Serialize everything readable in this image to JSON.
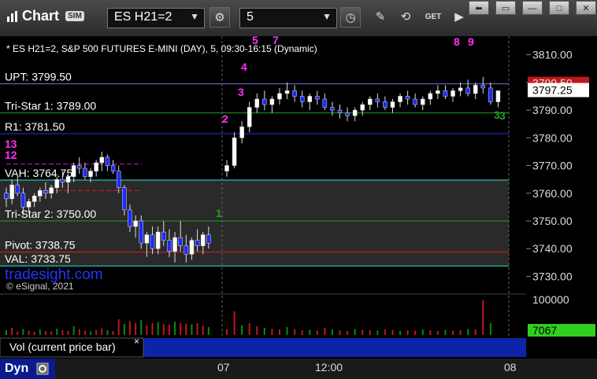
{
  "app": {
    "title": "Chart",
    "sim_badge": "SIM",
    "symbol": "ES H21=2",
    "interval": "5",
    "get_label": "GET"
  },
  "chart": {
    "header": "* ES H21=2, S&P 500 FUTURES E-MINI (DAY), 5, 09:30-16:15 (Dynamic)",
    "watermark": "tradesight.com",
    "copyright": "© eSignal, 2021",
    "levels": [
      {
        "label": "UPT: 3799.50",
        "value": 3799.5,
        "color": "#7b6fe0"
      },
      {
        "label": "Tri-Star 1: 3789.00",
        "value": 3789.0,
        "color": "#1fa01f"
      },
      {
        "label": "R1: 3781.50",
        "value": 3781.5,
        "color": "#2235e0"
      },
      {
        "label": "VAH: 3764.75",
        "value": 3764.75,
        "color": "#2fe0d6"
      },
      {
        "label": "Tri-Star 2: 3750.00",
        "value": 3750.0,
        "color": "#1fa01f"
      },
      {
        "label": "Pivot: 3738.75",
        "value": 3738.75,
        "color": "#e01f1f"
      },
      {
        "label": "VAL: 3733.75",
        "value": 3733.75,
        "color": "#2fe0d6"
      }
    ],
    "price_ticks": [
      "3810.00",
      "3800.00",
      "3790.00",
      "3780.00",
      "3770.00",
      "3760.00",
      "3750.00",
      "3740.00",
      "3730.00"
    ],
    "last_price_red": "3799.50",
    "last_price": "3797.25",
    "volume_tick": "100000",
    "volume_last": "7067",
    "volume_panel_label": "Vol (current price bar)",
    "time_ticks": [
      "07",
      "12:00",
      "08"
    ],
    "dyn_label": "Dyn",
    "markers": [
      {
        "text": "13",
        "color": "#ff2fff"
      },
      {
        "text": "12",
        "color": "#ff2fff"
      },
      {
        "text": "2",
        "color": "#ff2fff"
      },
      {
        "text": "3",
        "color": "#ff2fff"
      },
      {
        "text": "4",
        "color": "#ff2fff"
      },
      {
        "text": "5",
        "color": "#ff2fff"
      },
      {
        "text": "7",
        "color": "#ff2fff"
      },
      {
        "text": "8",
        "color": "#ff2fff"
      },
      {
        "text": "9",
        "color": "#ff2fff"
      },
      {
        "text": "1",
        "color": "#1fa01f"
      },
      {
        "text": "3",
        "color": "#1fa01f"
      },
      {
        "text": "3",
        "color": "#1fa01f"
      }
    ]
  },
  "chart_data": {
    "type": "candlestick",
    "y_range": [
      3727,
      3815
    ],
    "candles": [
      [
        3760,
        3762,
        3755,
        3758
      ],
      [
        3758,
        3765,
        3756,
        3763
      ],
      [
        3763,
        3766,
        3759,
        3760
      ],
      [
        3760,
        3762,
        3752,
        3755
      ],
      [
        3755,
        3758,
        3753,
        3757
      ],
      [
        3757,
        3760,
        3755,
        3759
      ],
      [
        3759,
        3762,
        3757,
        3761
      ],
      [
        3761,
        3764,
        3758,
        3760
      ],
      [
        3760,
        3763,
        3758,
        3762
      ],
      [
        3762,
        3766,
        3760,
        3765
      ],
      [
        3765,
        3768,
        3762,
        3764
      ],
      [
        3764,
        3767,
        3760,
        3766
      ],
      [
        3766,
        3771,
        3764,
        3770
      ],
      [
        3770,
        3773,
        3767,
        3769
      ],
      [
        3769,
        3771,
        3765,
        3766
      ],
      [
        3766,
        3769,
        3764,
        3768
      ],
      [
        3768,
        3772,
        3766,
        3771
      ],
      [
        3771,
        3775,
        3768,
        3773
      ],
      [
        3773,
        3774,
        3768,
        3770
      ],
      [
        3770,
        3772,
        3767,
        3768
      ],
      [
        3768,
        3770,
        3760,
        3762
      ],
      [
        3762,
        3763,
        3752,
        3754
      ],
      [
        3754,
        3756,
        3746,
        3748
      ],
      [
        3748,
        3752,
        3744,
        3750
      ],
      [
        3750,
        3752,
        3740,
        3742
      ],
      [
        3742,
        3746,
        3737,
        3745
      ],
      [
        3745,
        3748,
        3738,
        3740
      ],
      [
        3740,
        3748,
        3738,
        3746
      ],
      [
        3746,
        3750,
        3741,
        3743
      ],
      [
        3743,
        3747,
        3737,
        3739
      ],
      [
        3739,
        3746,
        3735,
        3744
      ],
      [
        3744,
        3750,
        3739,
        3741
      ],
      [
        3741,
        3745,
        3735,
        3738
      ],
      [
        3738,
        3744,
        3736,
        3743
      ],
      [
        3743,
        3747,
        3739,
        3741
      ],
      [
        3741,
        3746,
        3738,
        3745
      ],
      [
        3745,
        3748,
        3740,
        3742
      ],
      [
        3768,
        3772,
        3766,
        3770
      ],
      [
        3770,
        3782,
        3769,
        3780
      ],
      [
        3780,
        3786,
        3778,
        3784
      ],
      [
        3784,
        3793,
        3782,
        3791
      ],
      [
        3791,
        3796,
        3789,
        3794
      ],
      [
        3794,
        3797,
        3790,
        3792
      ],
      [
        3792,
        3795,
        3789,
        3794
      ],
      [
        3794,
        3798,
        3792,
        3796
      ],
      [
        3796,
        3800,
        3794,
        3797
      ],
      [
        3797,
        3799,
        3793,
        3795
      ],
      [
        3795,
        3797,
        3791,
        3793
      ],
      [
        3793,
        3796,
        3790,
        3795
      ],
      [
        3795,
        3797,
        3792,
        3794
      ],
      [
        3794,
        3796,
        3790,
        3791
      ],
      [
        3791,
        3793,
        3788,
        3790
      ],
      [
        3790,
        3792,
        3787,
        3789
      ],
      [
        3789,
        3791,
        3786,
        3788
      ],
      [
        3788,
        3791,
        3786,
        3790
      ],
      [
        3790,
        3793,
        3788,
        3792
      ],
      [
        3792,
        3795,
        3790,
        3794
      ],
      [
        3794,
        3796,
        3791,
        3793
      ],
      [
        3793,
        3795,
        3790,
        3791
      ],
      [
        3791,
        3794,
        3789,
        3793
      ],
      [
        3793,
        3796,
        3791,
        3795
      ],
      [
        3795,
        3797,
        3792,
        3794
      ],
      [
        3794,
        3796,
        3791,
        3792
      ],
      [
        3792,
        3795,
        3790,
        3794
      ],
      [
        3794,
        3797,
        3792,
        3796
      ],
      [
        3796,
        3799,
        3794,
        3797
      ],
      [
        3797,
        3799,
        3794,
        3795
      ],
      [
        3795,
        3798,
        3793,
        3797
      ],
      [
        3797,
        3800,
        3795,
        3798
      ],
      [
        3798,
        3801,
        3795,
        3796
      ],
      [
        3796,
        3800,
        3794,
        3799
      ],
      [
        3799,
        3802,
        3796,
        3798
      ],
      [
        3798,
        3800,
        3792,
        3793
      ],
      [
        3793,
        3797,
        3791,
        3797
      ]
    ],
    "volume": [
      12,
      18,
      9,
      15,
      11,
      8,
      14,
      10,
      9,
      16,
      12,
      10,
      22,
      15,
      11,
      9,
      13,
      17,
      12,
      10,
      40,
      28,
      35,
      30,
      38,
      25,
      30,
      33,
      28,
      26,
      34,
      31,
      29,
      27,
      30,
      24,
      20,
      15,
      60,
      25,
      30,
      22,
      18,
      16,
      14,
      20,
      15,
      12,
      13,
      11,
      18,
      14,
      12,
      10,
      15,
      13,
      12,
      11,
      14,
      13,
      10,
      12,
      11,
      14,
      12,
      10,
      13,
      11,
      12,
      15,
      14,
      88,
      30
    ]
  }
}
